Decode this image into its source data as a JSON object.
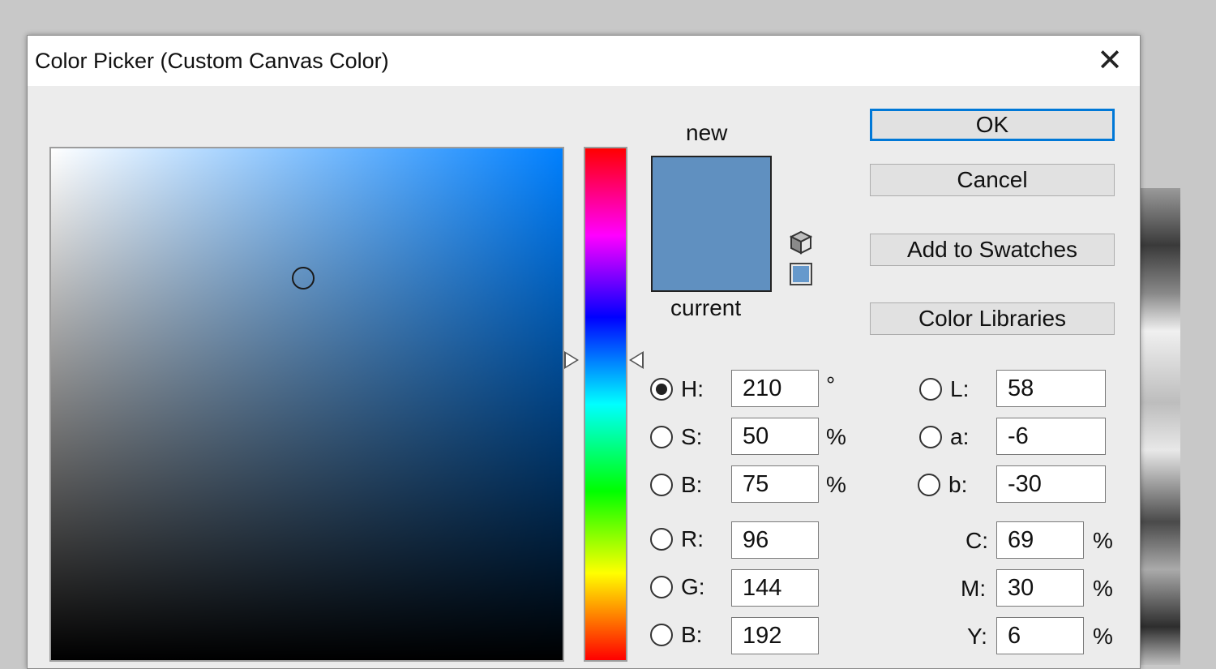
{
  "dialog": {
    "title": "Color Picker (Custom Canvas Color)",
    "close_glyph": "✕"
  },
  "swatch": {
    "new_label": "new",
    "current_label": "current",
    "new_color": "#6090c0",
    "current_color": "#6090c0",
    "websafe_color": "#6699cc"
  },
  "buttons": {
    "ok": "OK",
    "cancel": "Cancel",
    "add_to_swatches": "Add to Swatches",
    "color_libraries": "Color Libraries"
  },
  "hsb": {
    "h_label": "H:",
    "h_value": "210",
    "h_unit": "°",
    "s_label": "S:",
    "s_value": "50",
    "s_unit": "%",
    "b_label": "B:",
    "b_value": "75",
    "b_unit": "%"
  },
  "rgb": {
    "r_label": "R:",
    "r_value": "96",
    "g_label": "G:",
    "g_value": "144",
    "b_label": "B:",
    "b_value": "192"
  },
  "lab": {
    "l_label": "L:",
    "l_value": "58",
    "a_label": "a:",
    "a_value": "-6",
    "b_label": "b:",
    "b_value": "-30"
  },
  "cmyk": {
    "c_label": "C:",
    "c_value": "69",
    "c_unit": "%",
    "m_label": "M:",
    "m_value": "30",
    "m_unit": "%",
    "y_label": "Y:",
    "y_value": "6",
    "y_unit": "%"
  },
  "hue_color": "#0080ff",
  "selected_mode": "H"
}
